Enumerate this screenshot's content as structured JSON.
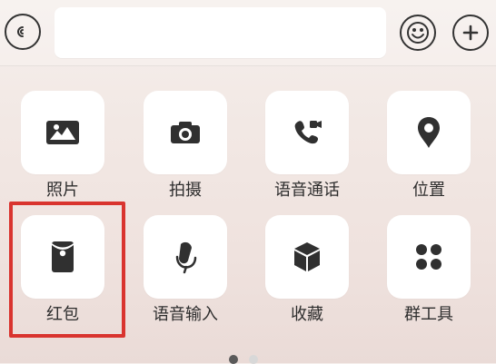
{
  "top_bar": {
    "icons": [
      "voice-icon",
      "emoji-icon",
      "plus-icon"
    ]
  },
  "tools": [
    {
      "label": "照片",
      "icon": "photo-icon"
    },
    {
      "label": "拍摄",
      "icon": "camera-icon"
    },
    {
      "label": "语音通话",
      "icon": "voice-call-icon"
    },
    {
      "label": "位置",
      "icon": "location-icon"
    },
    {
      "label": "红包",
      "icon": "red-envelope-icon"
    },
    {
      "label": "语音输入",
      "icon": "microphone-icon"
    },
    {
      "label": "收藏",
      "icon": "favorite-icon"
    },
    {
      "label": "群工具",
      "icon": "group-tools-icon"
    }
  ],
  "highlight": {
    "target": "红包",
    "color": "#d9342f"
  },
  "pager": {
    "active_page": 1,
    "page_count": 2
  }
}
